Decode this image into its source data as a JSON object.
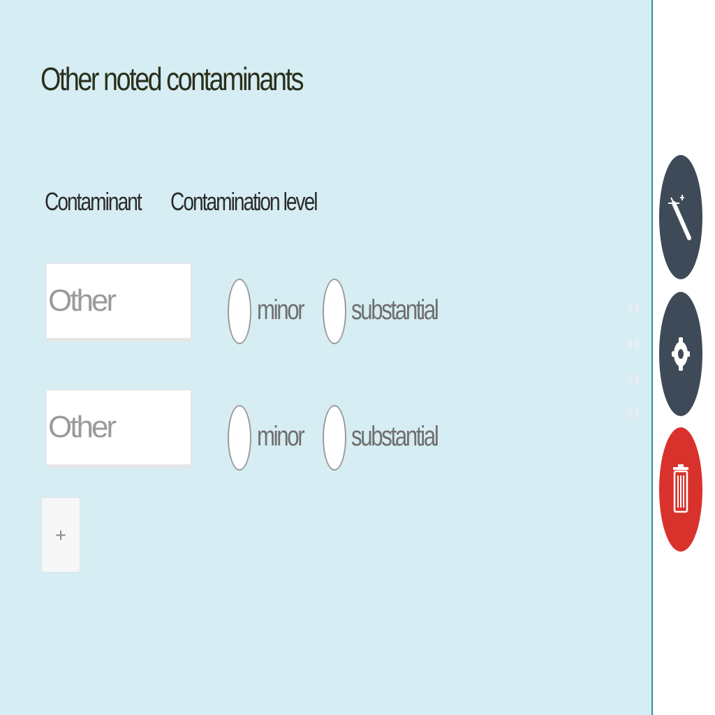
{
  "form": {
    "title": "Other noted contaminants",
    "columns": {
      "contaminant": "Contaminant",
      "level": "Contamination level"
    },
    "rows": [
      {
        "placeholder": "Other",
        "options": [
          "minor",
          "substantial"
        ]
      },
      {
        "placeholder": "Other",
        "options": [
          "minor",
          "substantial"
        ]
      }
    ],
    "add_label": "+"
  },
  "toolbar": {
    "icons": [
      "magic-wand-icon",
      "gear-icon",
      "trash-icon"
    ],
    "colors": {
      "dark": "#3e4a57",
      "danger": "#d9322c"
    }
  },
  "theme": {
    "panel_bg": "#d6edf3",
    "border": "#2c8fb4"
  }
}
